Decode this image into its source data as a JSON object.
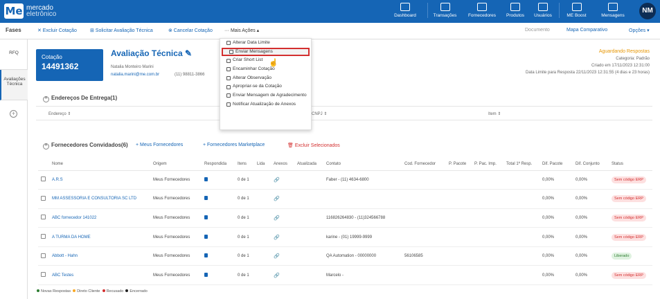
{
  "brand": {
    "logo": "Me",
    "line1": "mercado",
    "line2": "eletrônico"
  },
  "nav": [
    "Dashboard",
    "Transações",
    "Fornecedores",
    "Produtos",
    "Usuários",
    "ME Boost",
    "Mensagens"
  ],
  "user_initials": "NM",
  "subbar": {
    "fases": "Fases",
    "excluir": "✕ Excluir Cotação",
    "solicitar": "⊞ Solicitar Avaliação Técnica",
    "cancelar": "⊗ Cancelar Cotação",
    "mais": "··· Mais Ações ▴",
    "documento": "Documento",
    "mapa": "Mapa Comparativo",
    "opcoes": "Opções ▾"
  },
  "left_nav": {
    "rfq": "RFQ",
    "avaliacoes": "Avaliações Técnica",
    "add": "+"
  },
  "cotacao": {
    "label": "Cotação",
    "number": "14491362"
  },
  "title": "Avaliação Técnica ✎",
  "contact": {
    "name": "Natalia Monteiro Marini",
    "email": "natalia.marini@me.com.br",
    "phone": "(11) 98811-3866"
  },
  "right_info": {
    "status": "Aguardando Respostas",
    "categoria": "Categoria: Padrão",
    "criado": "Criado em 17/11/2023 12:31:00",
    "limite": "Data Limite para Resposta 22/11/2023 12:31:55 (4 dias e 23 horas)"
  },
  "enderecos": {
    "title": "Endereços De Entrega(1)",
    "col_endereco": "Endereço ⇕",
    "col_cnpj": "CNPJ ⇕",
    "col_item": "Item ⇕"
  },
  "fornecedores": {
    "title": "Fornecedores Convidados(6)",
    "meus": "+ Meus Fornecedores",
    "marketplace": "+ Fornecedores Marketplace",
    "excluir": "🗑 Excluir Selecionados"
  },
  "columns": [
    "",
    "Nome",
    "Origem",
    "Respondida",
    "Itens",
    "Lida",
    "Anexos",
    "Atualizada",
    "Contato",
    "Cod. Fornecedor",
    "P. Pacote",
    "P. Pac. Imp.",
    "Total 1ª Resp.",
    "Dif. Pacote",
    "Dif. Conjunto",
    "Status"
  ],
  "rows": [
    {
      "nome": "A.R.S",
      "origem": "Meus Fornecedores",
      "itens": "0 de 1",
      "contato": "Faber - (11) 4634-6800",
      "cod": "",
      "dif_pacote": "0,00%",
      "dif_conjunto": "0,00%",
      "status": "Sem código ERP",
      "status_type": "erp"
    },
    {
      "nome": "MM ASSESSORIA E CONSULTORIA SC LTD",
      "origem": "Meus Fornecedores",
      "itens": "0 de 1",
      "contato": "",
      "cod": "",
      "dif_pacote": "0,00%",
      "dif_conjunto": "0,00%",
      "status": "Sem código ERP",
      "status_type": "erp"
    },
    {
      "nome": "ABC fornecedor 141022",
      "origem": "Meus Fornecedores",
      "itens": "0 de 1",
      "contato": "116826264830 - (11)324566788",
      "cod": "",
      "dif_pacote": "0,00%",
      "dif_conjunto": "0,00%",
      "status": "Sem código ERP",
      "status_type": "erp"
    },
    {
      "nome": "A TURMA DA HOME",
      "origem": "Meus Fornecedores",
      "itens": "0 de 1",
      "contato": "karine - (01) 19999-9999",
      "cod": "",
      "dif_pacote": "0,00%",
      "dif_conjunto": "0,00%",
      "status": "Sem código ERP",
      "status_type": "erp"
    },
    {
      "nome": "Abbott - Hahn",
      "origem": "Meus Fornecedores",
      "itens": "0 de 1",
      "contato": "QA Automation - 00000000",
      "cod": "56106585",
      "dif_pacote": "0,00%",
      "dif_conjunto": "0,00%",
      "status": "Liberado",
      "status_type": "lib"
    },
    {
      "nome": "ABC Testes",
      "origem": "Meus Fornecedores",
      "itens": "0 de 1",
      "contato": "Marcelo -",
      "cod": "",
      "dif_pacote": "0,00%",
      "dif_conjunto": "0,00%",
      "status": "Sem código ERP",
      "status_type": "erp"
    }
  ],
  "legend": {
    "novas": "Novas Respostas",
    "direto": "Direto Cliente",
    "recusado": "Recusado",
    "encerrado": "Encerrado"
  },
  "menu": [
    "Alterar Data Limite",
    "Enviar Mensagens",
    "Criar Short List",
    "Encaminhar Cotação",
    "Alterar Observação",
    "Apropriar-se da Cotação",
    "Enviar Mensagem de Agradecimento",
    "Notificar Atualização de Anexos"
  ],
  "colors": {
    "primary": "#1565b5",
    "highlight": "#d32f2f",
    "status_pending": "#e69500"
  }
}
